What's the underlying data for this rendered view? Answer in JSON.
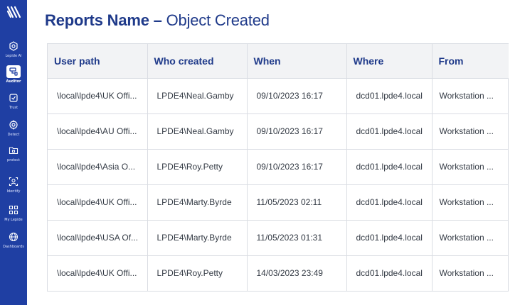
{
  "header": {
    "title_main": "Reports Name",
    "title_sep": " – ",
    "title_sub": "Object Created"
  },
  "sidebar": {
    "logo_icon": "lepide-logo-icon",
    "items": [
      {
        "label": "Lepide AI",
        "icon": "ai-icon",
        "active": false
      },
      {
        "label": "Auditor",
        "icon": "auditor-icon",
        "active": true
      },
      {
        "label": "Trust",
        "icon": "shield-check-icon",
        "active": false
      },
      {
        "label": "Detect",
        "icon": "target-icon",
        "active": false
      },
      {
        "label": "protect",
        "icon": "folder-lock-icon",
        "active": false
      },
      {
        "label": "Identify",
        "icon": "user-scan-icon",
        "active": false
      },
      {
        "label": "My Lepide",
        "icon": "grid-icon",
        "active": false
      },
      {
        "label": "Dashboards",
        "icon": "globe-icon",
        "active": false
      }
    ]
  },
  "table": {
    "columns": [
      "User path",
      "Who created",
      "When",
      "Where",
      "From"
    ],
    "rows": [
      [
        "\\local\\lpde4\\UK Offi...",
        "LPDE4\\Neal.Gamby",
        "09/10/2023 16:17",
        "dcd01.lpde4.local",
        "Workstation ..."
      ],
      [
        "\\local\\lpde4\\AU Offi...",
        "LPDE4\\Neal.Gamby",
        "09/10/2023 16:17",
        "dcd01.lpde4.local",
        "Workstation ..."
      ],
      [
        "\\local\\lpde4\\Asia O...",
        "LPDE4\\Roy.Petty",
        "09/10/2023 16:17",
        "dcd01.lpde4.local",
        "Workstation ..."
      ],
      [
        "\\local\\lpde4\\UK Offi...",
        "LPDE4\\Marty.Byrde",
        "11/05/2023 02:11",
        "dcd01.lpde4.local",
        "Workstation ..."
      ],
      [
        "\\local\\lpde4\\USA Of...",
        "LPDE4\\Marty.Byrde",
        "11/05/2023 01:31",
        "dcd01.lpde4.local",
        "Workstation ..."
      ],
      [
        "\\local\\lpde4\\UK Offi...",
        "LPDE4\\Roy.Petty",
        "14/03/2023 23:49",
        "dcd01.lpde4.local",
        "Workstation ..."
      ]
    ]
  },
  "colors": {
    "sidebar": "#1f3fa3",
    "title": "#1f3a8a",
    "header_bg": "#f2f3f5",
    "border": "#dadde3"
  }
}
